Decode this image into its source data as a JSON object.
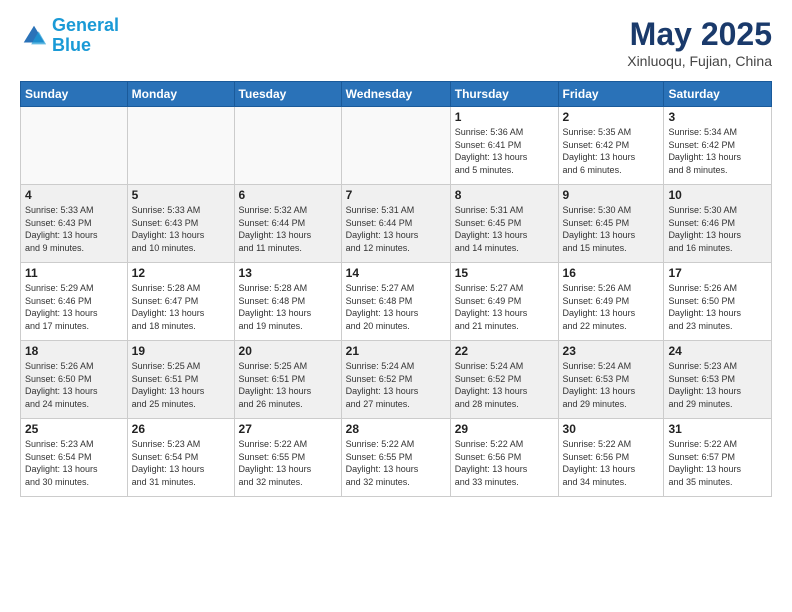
{
  "header": {
    "logo_line1": "General",
    "logo_line2": "Blue",
    "title": "May 2025",
    "subtitle": "Xinluoqu, Fujian, China"
  },
  "weekdays": [
    "Sunday",
    "Monday",
    "Tuesday",
    "Wednesday",
    "Thursday",
    "Friday",
    "Saturday"
  ],
  "weeks": [
    [
      {
        "day": "",
        "info": ""
      },
      {
        "day": "",
        "info": ""
      },
      {
        "day": "",
        "info": ""
      },
      {
        "day": "",
        "info": ""
      },
      {
        "day": "1",
        "info": "Sunrise: 5:36 AM\nSunset: 6:41 PM\nDaylight: 13 hours\nand 5 minutes."
      },
      {
        "day": "2",
        "info": "Sunrise: 5:35 AM\nSunset: 6:42 PM\nDaylight: 13 hours\nand 6 minutes."
      },
      {
        "day": "3",
        "info": "Sunrise: 5:34 AM\nSunset: 6:42 PM\nDaylight: 13 hours\nand 8 minutes."
      }
    ],
    [
      {
        "day": "4",
        "info": "Sunrise: 5:33 AM\nSunset: 6:43 PM\nDaylight: 13 hours\nand 9 minutes."
      },
      {
        "day": "5",
        "info": "Sunrise: 5:33 AM\nSunset: 6:43 PM\nDaylight: 13 hours\nand 10 minutes."
      },
      {
        "day": "6",
        "info": "Sunrise: 5:32 AM\nSunset: 6:44 PM\nDaylight: 13 hours\nand 11 minutes."
      },
      {
        "day": "7",
        "info": "Sunrise: 5:31 AM\nSunset: 6:44 PM\nDaylight: 13 hours\nand 12 minutes."
      },
      {
        "day": "8",
        "info": "Sunrise: 5:31 AM\nSunset: 6:45 PM\nDaylight: 13 hours\nand 14 minutes."
      },
      {
        "day": "9",
        "info": "Sunrise: 5:30 AM\nSunset: 6:45 PM\nDaylight: 13 hours\nand 15 minutes."
      },
      {
        "day": "10",
        "info": "Sunrise: 5:30 AM\nSunset: 6:46 PM\nDaylight: 13 hours\nand 16 minutes."
      }
    ],
    [
      {
        "day": "11",
        "info": "Sunrise: 5:29 AM\nSunset: 6:46 PM\nDaylight: 13 hours\nand 17 minutes."
      },
      {
        "day": "12",
        "info": "Sunrise: 5:28 AM\nSunset: 6:47 PM\nDaylight: 13 hours\nand 18 minutes."
      },
      {
        "day": "13",
        "info": "Sunrise: 5:28 AM\nSunset: 6:48 PM\nDaylight: 13 hours\nand 19 minutes."
      },
      {
        "day": "14",
        "info": "Sunrise: 5:27 AM\nSunset: 6:48 PM\nDaylight: 13 hours\nand 20 minutes."
      },
      {
        "day": "15",
        "info": "Sunrise: 5:27 AM\nSunset: 6:49 PM\nDaylight: 13 hours\nand 21 minutes."
      },
      {
        "day": "16",
        "info": "Sunrise: 5:26 AM\nSunset: 6:49 PM\nDaylight: 13 hours\nand 22 minutes."
      },
      {
        "day": "17",
        "info": "Sunrise: 5:26 AM\nSunset: 6:50 PM\nDaylight: 13 hours\nand 23 minutes."
      }
    ],
    [
      {
        "day": "18",
        "info": "Sunrise: 5:26 AM\nSunset: 6:50 PM\nDaylight: 13 hours\nand 24 minutes."
      },
      {
        "day": "19",
        "info": "Sunrise: 5:25 AM\nSunset: 6:51 PM\nDaylight: 13 hours\nand 25 minutes."
      },
      {
        "day": "20",
        "info": "Sunrise: 5:25 AM\nSunset: 6:51 PM\nDaylight: 13 hours\nand 26 minutes."
      },
      {
        "day": "21",
        "info": "Sunrise: 5:24 AM\nSunset: 6:52 PM\nDaylight: 13 hours\nand 27 minutes."
      },
      {
        "day": "22",
        "info": "Sunrise: 5:24 AM\nSunset: 6:52 PM\nDaylight: 13 hours\nand 28 minutes."
      },
      {
        "day": "23",
        "info": "Sunrise: 5:24 AM\nSunset: 6:53 PM\nDaylight: 13 hours\nand 29 minutes."
      },
      {
        "day": "24",
        "info": "Sunrise: 5:23 AM\nSunset: 6:53 PM\nDaylight: 13 hours\nand 29 minutes."
      }
    ],
    [
      {
        "day": "25",
        "info": "Sunrise: 5:23 AM\nSunset: 6:54 PM\nDaylight: 13 hours\nand 30 minutes."
      },
      {
        "day": "26",
        "info": "Sunrise: 5:23 AM\nSunset: 6:54 PM\nDaylight: 13 hours\nand 31 minutes."
      },
      {
        "day": "27",
        "info": "Sunrise: 5:22 AM\nSunset: 6:55 PM\nDaylight: 13 hours\nand 32 minutes."
      },
      {
        "day": "28",
        "info": "Sunrise: 5:22 AM\nSunset: 6:55 PM\nDaylight: 13 hours\nand 32 minutes."
      },
      {
        "day": "29",
        "info": "Sunrise: 5:22 AM\nSunset: 6:56 PM\nDaylight: 13 hours\nand 33 minutes."
      },
      {
        "day": "30",
        "info": "Sunrise: 5:22 AM\nSunset: 6:56 PM\nDaylight: 13 hours\nand 34 minutes."
      },
      {
        "day": "31",
        "info": "Sunrise: 5:22 AM\nSunset: 6:57 PM\nDaylight: 13 hours\nand 35 minutes."
      }
    ]
  ]
}
